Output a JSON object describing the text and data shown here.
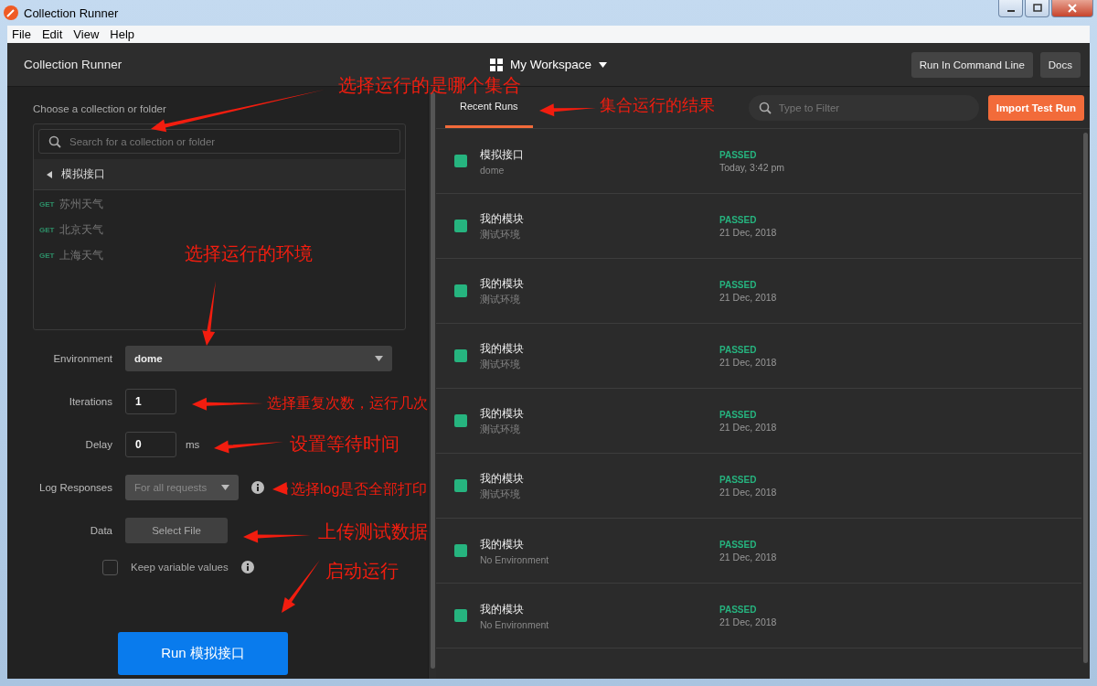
{
  "window": {
    "title": "Collection Runner"
  },
  "menu": [
    "File",
    "Edit",
    "View",
    "Help"
  ],
  "header": {
    "title": "Collection Runner",
    "workspace": "My Workspace",
    "buttons": [
      "Run In Command Line",
      "Docs"
    ]
  },
  "collection_picker": {
    "label": "Choose a collection or folder",
    "search_placeholder": "Search for a collection or folder",
    "folder": "模拟接口",
    "requests": [
      {
        "method": "GET",
        "name": "苏州天气"
      },
      {
        "method": "GET",
        "name": "北京天气"
      },
      {
        "method": "GET",
        "name": "上海天气"
      }
    ]
  },
  "settings": {
    "environment": {
      "label": "Environment",
      "value": "dome"
    },
    "iterations": {
      "label": "Iterations",
      "value": "1"
    },
    "delay": {
      "label": "Delay",
      "value": "0",
      "unit": "ms"
    },
    "log_responses": {
      "label": "Log Responses",
      "value": "For all requests",
      "disabled": true
    },
    "data": {
      "label": "Data",
      "button": "Select File"
    },
    "keep_variables": {
      "label": "Keep variable values",
      "checked": false
    }
  },
  "run_button": "Run 模拟接口",
  "results": {
    "tabs": [
      {
        "label": "Recent Runs",
        "selected": true
      }
    ],
    "filter_placeholder": "Type to Filter",
    "import_button": "Import Test Run",
    "runs": [
      {
        "name": "模拟接口",
        "environment": "dome",
        "status": "PASSED",
        "date": "Today, 3:42 pm"
      },
      {
        "name": "我的模块",
        "environment": "测试环境",
        "status": "PASSED",
        "date": "21 Dec, 2018"
      },
      {
        "name": "我的模块",
        "environment": "测试环境",
        "status": "PASSED",
        "date": "21 Dec, 2018"
      },
      {
        "name": "我的模块",
        "environment": "测试环境",
        "status": "PASSED",
        "date": "21 Dec, 2018"
      },
      {
        "name": "我的模块",
        "environment": "测试环境",
        "status": "PASSED",
        "date": "21 Dec, 2018"
      },
      {
        "name": "我的模块",
        "environment": "测试环境",
        "status": "PASSED",
        "date": "21 Dec, 2018"
      },
      {
        "name": "我的模块",
        "environment": "No Environment",
        "status": "PASSED",
        "date": "21 Dec, 2018"
      },
      {
        "name": "我的模块",
        "environment": "No Environment",
        "status": "PASSED",
        "date": "21 Dec, 2018"
      }
    ]
  },
  "annotations": [
    "选择运行的是哪个集合",
    "集合运行的结果",
    "选择运行的环境",
    "选择重复次数，运行几次",
    "设置等待时间",
    "选择log是否全部打印",
    "上传测试数据",
    "启动运行"
  ]
}
